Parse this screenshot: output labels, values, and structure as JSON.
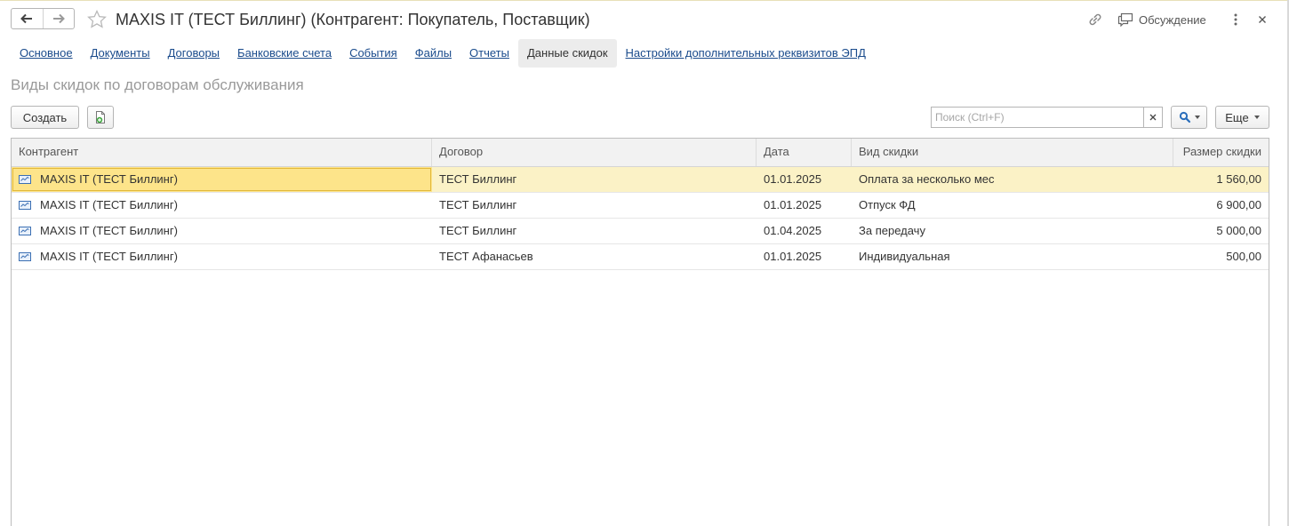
{
  "window": {
    "title": "MAXIS IT (ТЕСТ Биллинг) (Контрагент: Покупатель, Поставщик)",
    "discussion_label": "Обсуждение",
    "icons": {
      "back": "arrow-left-icon",
      "forward": "arrow-right-icon",
      "favorite": "star-icon",
      "link": "link-icon",
      "discussion": "chat-icon",
      "more": "more-vertical-icon",
      "close": "close-icon"
    }
  },
  "tabs": [
    {
      "label": "Основное",
      "active": false
    },
    {
      "label": "Документы",
      "active": false
    },
    {
      "label": "Договоры",
      "active": false
    },
    {
      "label": "Банковские счета",
      "active": false
    },
    {
      "label": "События",
      "active": false
    },
    {
      "label": "Файлы",
      "active": false
    },
    {
      "label": "Отчеты",
      "active": false
    },
    {
      "label": "Данные скидок",
      "active": true
    },
    {
      "label": "Настройки дополнительных реквизитов ЭПД",
      "active": false
    }
  ],
  "section": {
    "title": "Виды скидок по договорам обслуживания"
  },
  "toolbar": {
    "create_label": "Создать",
    "search_placeholder": "Поиск (Ctrl+F)",
    "search_value": "",
    "more_label": "Еще"
  },
  "table": {
    "columns": [
      "Контрагент",
      "Договор",
      "Дата",
      "Вид скидки",
      "Размер скидки"
    ],
    "rows": [
      {
        "counterparty": "MAXIS IT (ТЕСТ Биллинг)",
        "contract": "ТЕСТ Биллинг",
        "date": "01.01.2025",
        "discount_type": "Оплата за несколько мес",
        "amount": "1 560,00",
        "selected": true
      },
      {
        "counterparty": "MAXIS IT (ТЕСТ Биллинг)",
        "contract": "ТЕСТ Биллинг",
        "date": "01.01.2025",
        "discount_type": "Отпуск ФД",
        "amount": "6 900,00",
        "selected": false
      },
      {
        "counterparty": "MAXIS IT (ТЕСТ Биллинг)",
        "contract": "ТЕСТ Биллинг",
        "date": "01.04.2025",
        "discount_type": "За передачу",
        "amount": "5 000,00",
        "selected": false
      },
      {
        "counterparty": "MAXIS IT (ТЕСТ Биллинг)",
        "contract": "ТЕСТ Афанасьев",
        "date": "01.01.2025",
        "discount_type": "Индивидуальная",
        "amount": "500,00",
        "selected": false
      }
    ]
  },
  "colors": {
    "link": "#1a4b8c",
    "selected_row": "#fbf2c6",
    "selected_cell": "#fde48a"
  }
}
